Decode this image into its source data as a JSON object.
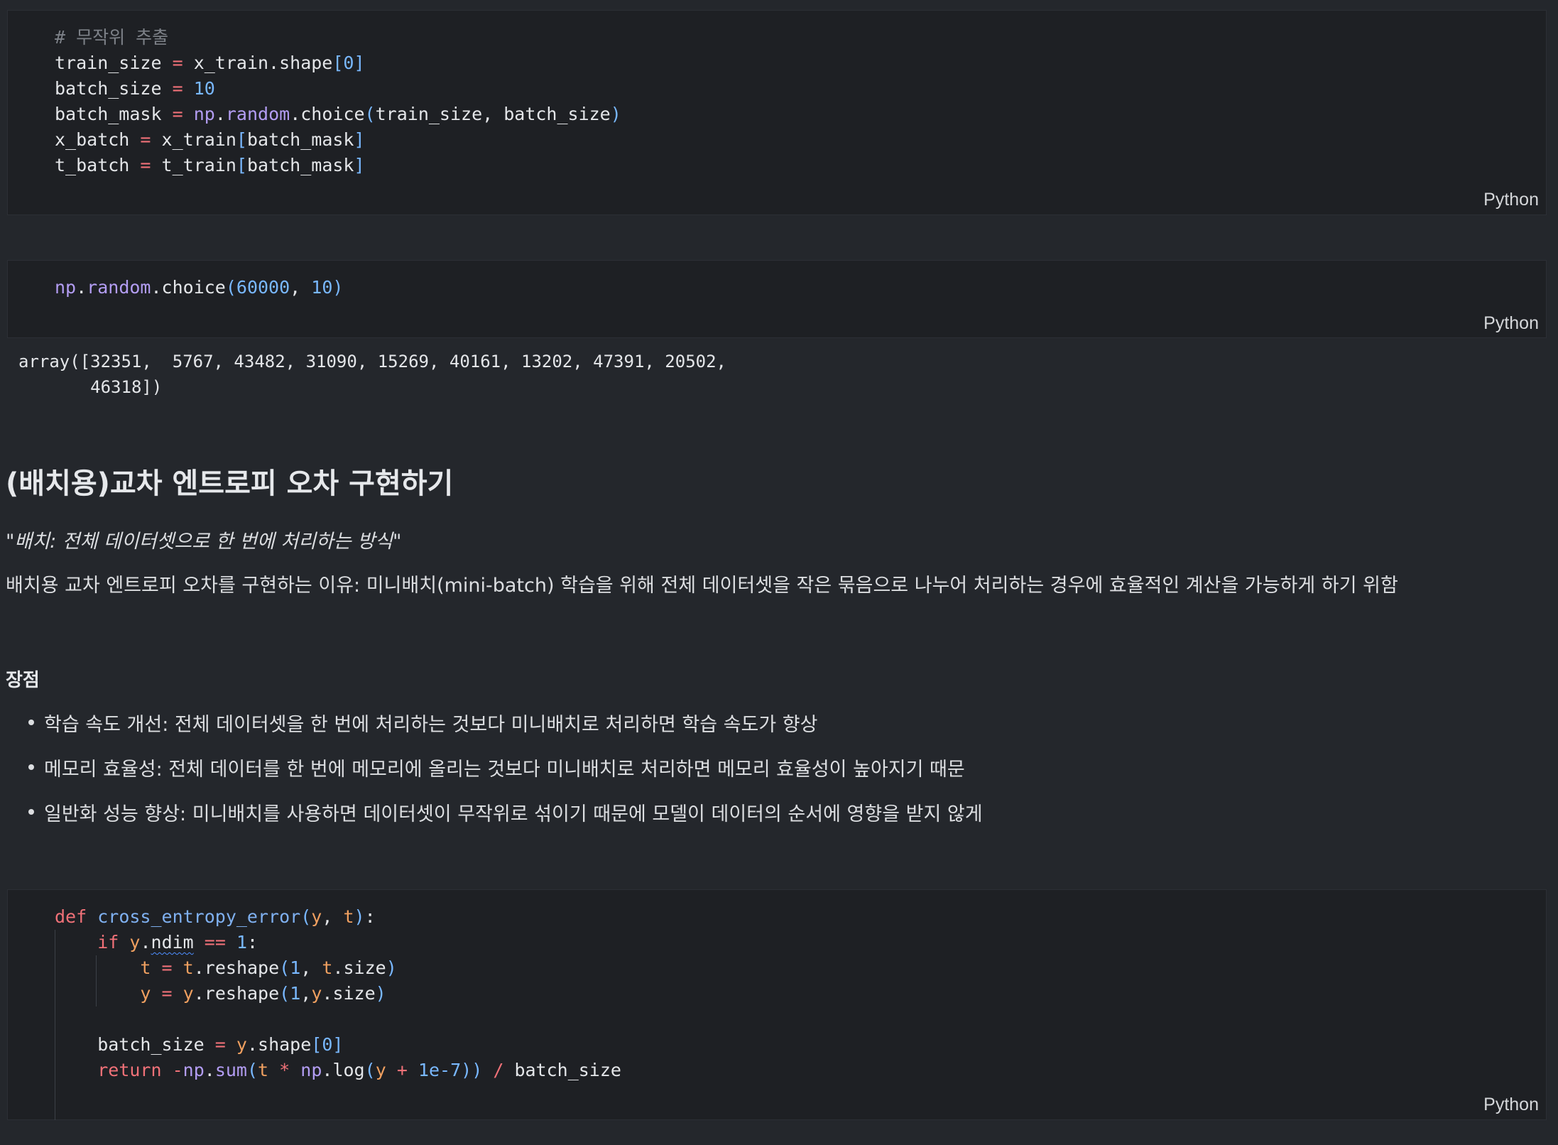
{
  "cell1": {
    "lines": [
      [
        {
          "t": "# 무작위 추출",
          "c": "cm"
        }
      ],
      [
        {
          "t": "train_size "
        },
        {
          "t": "=",
          "c": "op"
        },
        {
          "t": " x_train.shape"
        },
        {
          "t": "[",
          "c": "br"
        },
        {
          "t": "0",
          "c": "num"
        },
        {
          "t": "]",
          "c": "br"
        }
      ],
      [
        {
          "t": "batch_size "
        },
        {
          "t": "=",
          "c": "op"
        },
        {
          "t": " "
        },
        {
          "t": "10",
          "c": "num"
        }
      ],
      [
        {
          "t": "batch_mask "
        },
        {
          "t": "=",
          "c": "op"
        },
        {
          "t": " "
        },
        {
          "t": "np",
          "c": "np"
        },
        {
          "t": "."
        },
        {
          "t": "random",
          "c": "np"
        },
        {
          "t": ".choice"
        },
        {
          "t": "(",
          "c": "br"
        },
        {
          "t": "train_size, batch_size"
        },
        {
          "t": ")",
          "c": "br"
        }
      ],
      [
        {
          "t": "x_batch "
        },
        {
          "t": "=",
          "c": "op"
        },
        {
          "t": " x_train"
        },
        {
          "t": "[",
          "c": "br"
        },
        {
          "t": "batch_mask"
        },
        {
          "t": "]",
          "c": "br"
        }
      ],
      [
        {
          "t": "t_batch "
        },
        {
          "t": "=",
          "c": "op"
        },
        {
          "t": " t_train"
        },
        {
          "t": "[",
          "c": "br"
        },
        {
          "t": "batch_mask"
        },
        {
          "t": "]",
          "c": "br"
        }
      ]
    ],
    "language": "Python"
  },
  "cell2": {
    "lines": [
      [
        {
          "t": "np",
          "c": "np"
        },
        {
          "t": "."
        },
        {
          "t": "random",
          "c": "np"
        },
        {
          "t": ".choice"
        },
        {
          "t": "(",
          "c": "br"
        },
        {
          "t": "60000",
          "c": "num"
        },
        {
          "t": ", "
        },
        {
          "t": "10",
          "c": "num"
        },
        {
          "t": ")",
          "c": "br"
        }
      ]
    ],
    "language": "Python",
    "output": "array([32351,  5767, 43482, 31090, 15269, 40161, 13202, 47391, 20502,\n       46318])"
  },
  "markdown": {
    "heading": "(배치용)교차 엔트로피 오차 구현하기",
    "quote": "\"배치: 전체 데이터셋으로 한 번에 처리하는 방식\"",
    "reason": "배치용 교차 엔트로피 오차를 구현하는 이유: 미니배치(mini-batch) 학습을 위해 전체 데이터셋을 작은 묶음으로 나누어 처리하는 경우에 효율적인 계산을 가능하게 하기 위함",
    "advantages_title": "장점",
    "advantages": [
      "학습 속도 개선: 전체 데이터셋을 한 번에 처리하는 것보다 미니배치로 처리하면 학습 속도가 향상",
      "메모리 효율성: 전체 데이터를 한 번에 메모리에 올리는 것보다 미니배치로 처리하면 메모리 효율성이 높아지기 때문",
      "일반화 성능 향상: 미니배치를 사용하면 데이터셋이 무작위로 섞이기 때문에 모델이 데이터의 순서에 영향을 받지 않게"
    ]
  },
  "cell3": {
    "lines": [
      [
        {
          "t": "def",
          "c": "kw"
        },
        {
          "t": " "
        },
        {
          "t": "cross_entropy_error",
          "c": "fn"
        },
        {
          "t": "(",
          "c": "br"
        },
        {
          "t": "y",
          "c": "prm"
        },
        {
          "t": ", "
        },
        {
          "t": "t",
          "c": "prm"
        },
        {
          "t": ")",
          "c": "br"
        },
        {
          "t": ":"
        }
      ],
      [
        {
          "t": "    "
        },
        {
          "t": "if",
          "c": "kw"
        },
        {
          "t": " "
        },
        {
          "t": "y",
          "c": "prm"
        },
        {
          "t": "."
        },
        {
          "t": "ndim",
          "c": "sq"
        },
        {
          "t": " "
        },
        {
          "t": "==",
          "c": "op"
        },
        {
          "t": " "
        },
        {
          "t": "1",
          "c": "num"
        },
        {
          "t": ":"
        }
      ],
      [
        {
          "t": "        "
        },
        {
          "t": "t",
          "c": "prm"
        },
        {
          "t": " "
        },
        {
          "t": "=",
          "c": "op"
        },
        {
          "t": " "
        },
        {
          "t": "t",
          "c": "prm"
        },
        {
          "t": ".reshape"
        },
        {
          "t": "(",
          "c": "br"
        },
        {
          "t": "1",
          "c": "num"
        },
        {
          "t": ", "
        },
        {
          "t": "t",
          "c": "prm"
        },
        {
          "t": ".size"
        },
        {
          "t": ")",
          "c": "br"
        }
      ],
      [
        {
          "t": "        "
        },
        {
          "t": "y",
          "c": "prm"
        },
        {
          "t": " "
        },
        {
          "t": "=",
          "c": "op"
        },
        {
          "t": " "
        },
        {
          "t": "y",
          "c": "prm"
        },
        {
          "t": ".reshape"
        },
        {
          "t": "(",
          "c": "br"
        },
        {
          "t": "1",
          "c": "num"
        },
        {
          "t": ","
        },
        {
          "t": "y",
          "c": "prm"
        },
        {
          "t": ".size"
        },
        {
          "t": ")",
          "c": "br"
        }
      ],
      [],
      [
        {
          "t": "    batch_size "
        },
        {
          "t": "=",
          "c": "op"
        },
        {
          "t": " "
        },
        {
          "t": "y",
          "c": "prm"
        },
        {
          "t": ".shape"
        },
        {
          "t": "[",
          "c": "br"
        },
        {
          "t": "0",
          "c": "num"
        },
        {
          "t": "]",
          "c": "br"
        }
      ],
      [
        {
          "t": "    "
        },
        {
          "t": "return",
          "c": "kw"
        },
        {
          "t": " "
        },
        {
          "t": "-",
          "c": "op"
        },
        {
          "t": "np",
          "c": "np"
        },
        {
          "t": "."
        },
        {
          "t": "sum",
          "c": "np"
        },
        {
          "t": "(",
          "c": "br"
        },
        {
          "t": "t",
          "c": "prm"
        },
        {
          "t": " "
        },
        {
          "t": "*",
          "c": "op"
        },
        {
          "t": " "
        },
        {
          "t": "np",
          "c": "np"
        },
        {
          "t": ".log"
        },
        {
          "t": "(",
          "c": "br"
        },
        {
          "t": "y",
          "c": "prm"
        },
        {
          "t": " "
        },
        {
          "t": "+",
          "c": "op"
        },
        {
          "t": " "
        },
        {
          "t": "1e-7",
          "c": "num"
        },
        {
          "t": "))",
          "c": "br"
        },
        {
          "t": " "
        },
        {
          "t": "/",
          "c": "op"
        },
        {
          "t": " batch_size"
        }
      ]
    ],
    "language": "Python"
  }
}
